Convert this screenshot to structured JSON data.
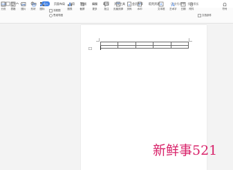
{
  "menu_tabs": [
    "开始",
    "插入",
    "页面布局",
    "引用",
    "审阅",
    "视图",
    "章节",
    "开发工具",
    "会员专享",
    "稻壳资源"
  ],
  "active_tab": "插入",
  "search_label": "Q 查找命令、搜索模板",
  "ribbon": {
    "row_items": [
      "分页",
      "表格",
      "图片",
      "形状",
      "图标",
      "图表",
      "截屏",
      "更多",
      "批注",
      "页眉页脚",
      "页码",
      "水印",
      "文本框",
      "艺术字",
      "日期",
      "附件",
      "文档部件",
      "符号",
      "公式"
    ],
    "small_items": [
      "流程图",
      "思维导图",
      "在线流程图",
      "在线脑图",
      "首字下沉",
      "对象"
    ]
  },
  "colors": {
    "accent": "#3f7fe3",
    "watermark": "#d8236a"
  },
  "watermark_text": "新鲜事521"
}
